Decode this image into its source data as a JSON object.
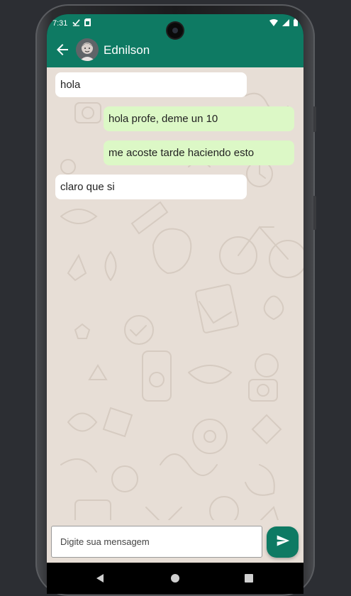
{
  "status_bar": {
    "time": "7:31",
    "left_icons": [
      "check-icon",
      "sim-card-icon"
    ],
    "right_icons": [
      "wifi-icon",
      "signal-icon",
      "battery-icon"
    ]
  },
  "header": {
    "contact_name": "Ednilson",
    "back_icon": "arrow-back-icon",
    "avatar": "contact-avatar"
  },
  "messages": [
    {
      "direction": "received",
      "text": "hola"
    },
    {
      "direction": "sent",
      "text": "hola profe, deme un 10"
    },
    {
      "direction": "sent",
      "text": "me acoste tarde haciendo esto"
    },
    {
      "direction": "received",
      "text": "claro que si"
    }
  ],
  "composer": {
    "placeholder": "Digite sua mensagem",
    "value": "",
    "send_icon": "send-icon"
  },
  "nav_bar": {
    "buttons": [
      "back-triangle-icon",
      "home-circle-icon",
      "recents-square-icon"
    ]
  },
  "colors": {
    "primary": "#0e7a63",
    "chat_background": "#e7ded6",
    "sent_bubble": "#dcf8c6",
    "received_bubble": "#ffffff"
  }
}
